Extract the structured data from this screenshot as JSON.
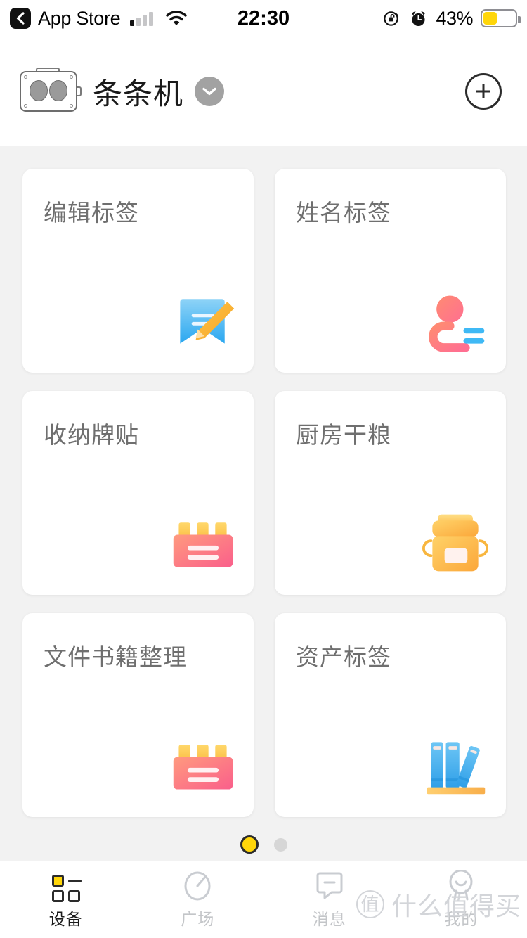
{
  "status_bar": {
    "back_label": "App Store",
    "back_icon": "chevron-left-icon",
    "signal_icon": "cellular-signal-icon",
    "wifi_icon": "wifi-icon",
    "time": "22:30",
    "rotation_lock_icon": "rotation-lock-icon",
    "alarm_icon": "alarm-clock-icon",
    "battery_percent": "43%",
    "battery_level": 43,
    "battery_color": "#ffd60a"
  },
  "header": {
    "device_icon": "label-printer-icon",
    "title": "条条机",
    "dropdown_icon": "chevron-down-icon",
    "add_icon": "plus-circle-icon"
  },
  "grid": {
    "cards": [
      {
        "title": "编辑标签",
        "icon": "note-pencil-icon"
      },
      {
        "title": "姓名标签",
        "icon": "person-name-icon"
      },
      {
        "title": "收纳牌贴",
        "icon": "storage-label-icon"
      },
      {
        "title": "厨房干粮",
        "icon": "kitchen-jar-icon"
      },
      {
        "title": "文件书籍整理",
        "icon": "storage-label-icon"
      },
      {
        "title": "资产标签",
        "icon": "books-shelf-icon"
      }
    ]
  },
  "pagination": {
    "total": 2,
    "active_index": 0
  },
  "tabbar": {
    "items": [
      {
        "label": "设备",
        "icon": "device-grid-icon",
        "active": true
      },
      {
        "label": "广场",
        "icon": "compass-icon",
        "active": false
      },
      {
        "label": "消息",
        "icon": "message-icon",
        "active": false
      },
      {
        "label": "我的",
        "icon": "profile-icon",
        "active": false
      }
    ]
  },
  "watermark": {
    "badge": "值",
    "text": "什么值得买"
  }
}
